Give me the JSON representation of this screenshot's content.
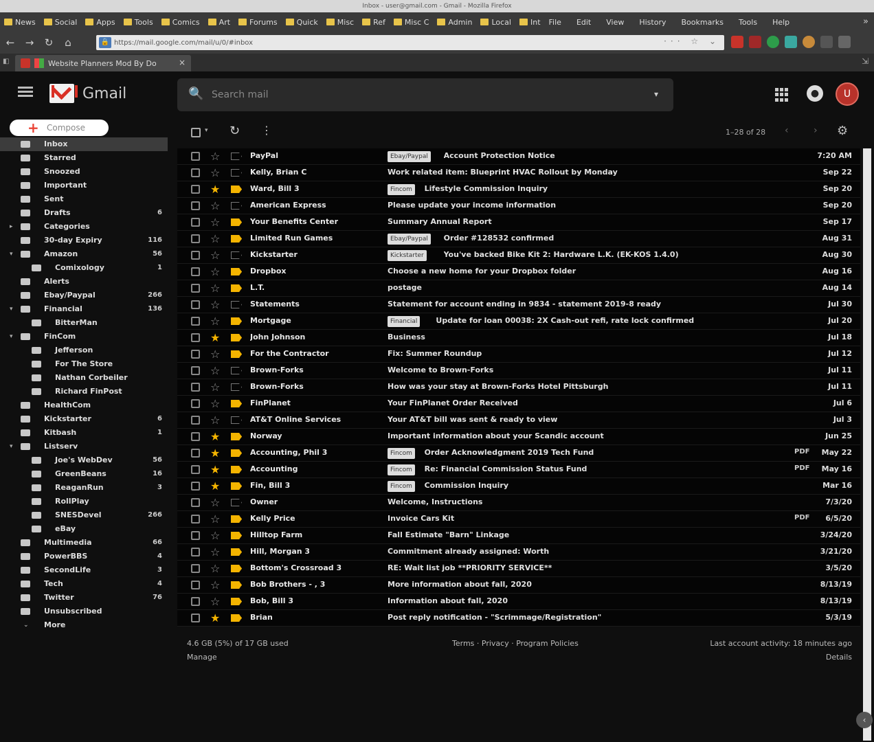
{
  "window": {
    "title": "Inbox - user@gmail.com - Gmail - Mozilla Firefox"
  },
  "menubar": {
    "items": [
      "File",
      "Edit",
      "View",
      "History",
      "Bookmarks",
      "Tools",
      "Help"
    ],
    "bookmarks": [
      "News",
      "Social",
      "Apps",
      "Tools",
      "Comics",
      "Art",
      "Forums",
      "Quick",
      "Misc",
      "Ref",
      "Misc C",
      "Admin",
      "Local",
      "Int"
    ]
  },
  "navbar": {
    "url": "https://mail.google.com/mail/u/0/#inbox"
  },
  "tab": {
    "title": "Website Planners Mod By Do",
    "close": "×"
  },
  "header": {
    "product_name": "Gmail",
    "search_placeholder": "Search mail",
    "avatar_initial": "U"
  },
  "sidebar": {
    "compose_label": "Compose",
    "items": [
      {
        "label": "Inbox",
        "count": "",
        "indent": 0,
        "caret": "",
        "active": true
      },
      {
        "label": "Starred",
        "count": "",
        "indent": 0,
        "caret": ""
      },
      {
        "label": "Snoozed",
        "count": "",
        "indent": 0,
        "caret": ""
      },
      {
        "label": "Important",
        "count": "",
        "indent": 0,
        "caret": ""
      },
      {
        "label": "Sent",
        "count": "",
        "indent": 0,
        "caret": ""
      },
      {
        "label": "Drafts",
        "count": "6",
        "indent": 0,
        "caret": ""
      },
      {
        "label": "Categories",
        "count": "",
        "indent": 0,
        "caret": "▸"
      },
      {
        "label": "30-day Expiry",
        "count": "116",
        "indent": 0,
        "caret": ""
      },
      {
        "label": "Amazon",
        "count": "56",
        "indent": 0,
        "caret": "▾"
      },
      {
        "label": "Comixology",
        "count": "1",
        "indent": 1,
        "caret": ""
      },
      {
        "label": "Alerts",
        "count": "",
        "indent": 0,
        "caret": ""
      },
      {
        "label": "Ebay/Paypal",
        "count": "266",
        "indent": 0,
        "caret": ""
      },
      {
        "label": "Financial",
        "count": "136",
        "indent": 0,
        "caret": "▾"
      },
      {
        "label": "BitterMan",
        "count": "",
        "indent": 1,
        "caret": ""
      },
      {
        "label": "FinCom",
        "count": "",
        "indent": 0,
        "caret": "▾"
      },
      {
        "label": "Jefferson",
        "count": "",
        "indent": 1,
        "caret": ""
      },
      {
        "label": "For The Store",
        "count": "",
        "indent": 1,
        "caret": ""
      },
      {
        "label": "Nathan Corbeiler",
        "count": "",
        "indent": 1,
        "caret": ""
      },
      {
        "label": "Richard FinPost",
        "count": "",
        "indent": 1,
        "caret": ""
      },
      {
        "label": "HealthCom",
        "count": "",
        "indent": 0,
        "caret": ""
      },
      {
        "label": "Kickstarter",
        "count": "6",
        "indent": 0,
        "caret": ""
      },
      {
        "label": "Kitbash",
        "count": "1",
        "indent": 0,
        "caret": ""
      },
      {
        "label": "Listserv",
        "count": "",
        "indent": 0,
        "caret": "▾"
      },
      {
        "label": "Joe's WebDev",
        "count": "56",
        "indent": 1,
        "caret": ""
      },
      {
        "label": "GreenBeans",
        "count": "16",
        "indent": 1,
        "caret": ""
      },
      {
        "label": "ReaganRun",
        "count": "3",
        "indent": 1,
        "caret": ""
      },
      {
        "label": "RollPlay",
        "count": "",
        "indent": 1,
        "caret": ""
      },
      {
        "label": "SNESDevel",
        "count": "266",
        "indent": 1,
        "caret": ""
      },
      {
        "label": "eBay",
        "count": "",
        "indent": 1,
        "caret": ""
      },
      {
        "label": "Multimedia",
        "count": "66",
        "indent": 0,
        "caret": ""
      },
      {
        "label": "PowerBBS",
        "count": "4",
        "indent": 0,
        "caret": ""
      },
      {
        "label": "SecondLife",
        "count": "3",
        "indent": 0,
        "caret": ""
      },
      {
        "label": "Tech",
        "count": "4",
        "indent": 0,
        "caret": ""
      },
      {
        "label": "Twitter",
        "count": "76",
        "indent": 0,
        "caret": ""
      },
      {
        "label": "Unsubscribed",
        "count": "",
        "indent": 0,
        "caret": ""
      },
      {
        "label": "More",
        "count": "",
        "indent": 0,
        "caret": "⌄",
        "more": true
      }
    ]
  },
  "toolbar": {
    "range": "1–28 of 28",
    "prev": "‹",
    "next": "›"
  },
  "emails": [
    {
      "sender": "PayPal",
      "tag": "Ebay/Paypal",
      "subject": "Account Protection Notice",
      "date": "7:20 AM",
      "starred": false,
      "important": false,
      "attachment": ""
    },
    {
      "sender": "Kelly, Brian C",
      "tag": "",
      "subject": "Work related item: Blueprint HVAC Rollout by Monday",
      "date": "Sep 22",
      "starred": false,
      "important": false,
      "attachment": ""
    },
    {
      "sender": "Ward, Bill 3",
      "tag": "Fincom",
      "subject": "Lifestyle Commission Inquiry",
      "date": "Sep 20",
      "starred": true,
      "important": true,
      "attachment": ""
    },
    {
      "sender": "American Express",
      "tag": "",
      "subject": "Please update your income information",
      "date": "Sep 20",
      "starred": false,
      "important": false,
      "attachment": ""
    },
    {
      "sender": "Your Benefits Center",
      "tag": "",
      "subject": "Summary Annual Report",
      "date": "Sep 17",
      "starred": false,
      "important": true,
      "attachment": ""
    },
    {
      "sender": "Limited Run Games",
      "tag": "Ebay/Paypal",
      "subject": "Order #128532 confirmed",
      "date": "Aug 31",
      "starred": false,
      "important": true,
      "attachment": ""
    },
    {
      "sender": "Kickstarter",
      "tag": "Kickstarter",
      "subject": "You've backed Bike Kit 2: Hardware L.K. (EK-KOS 1.4.0)",
      "date": "Aug 30",
      "starred": false,
      "important": false,
      "attachment": ""
    },
    {
      "sender": "Dropbox",
      "tag": "",
      "subject": "Choose a new home for your Dropbox folder",
      "date": "Aug 16",
      "starred": false,
      "important": true,
      "attachment": ""
    },
    {
      "sender": "L.T.",
      "tag": "",
      "subject": "postage",
      "date": "Aug 14",
      "starred": false,
      "important": true,
      "attachment": ""
    },
    {
      "sender": "Statements",
      "tag": "",
      "subject": "Statement for account ending in 9834 - statement 2019-8 ready",
      "date": "Jul 30",
      "starred": false,
      "important": false,
      "attachment": ""
    },
    {
      "sender": "Mortgage",
      "tag": "Financial",
      "subject": "Update for loan 00038: 2X Cash-out refi, rate lock confirmed",
      "date": "Jul 20",
      "starred": false,
      "important": true,
      "attachment": ""
    },
    {
      "sender": "John Johnson",
      "tag": "",
      "subject": "Business",
      "date": "Jul 18",
      "starred": true,
      "important": true,
      "attachment": ""
    },
    {
      "sender": "For the Contractor",
      "tag": "",
      "subject": "Fix: Summer Roundup",
      "date": "Jul 12",
      "starred": false,
      "important": true,
      "attachment": ""
    },
    {
      "sender": "Brown-Forks",
      "tag": "",
      "subject": "Welcome to Brown-Forks",
      "date": "Jul 11",
      "starred": false,
      "important": false,
      "attachment": ""
    },
    {
      "sender": "Brown-Forks",
      "tag": "",
      "subject": "How was your stay at Brown-Forks Hotel Pittsburgh",
      "date": "Jul 11",
      "starred": false,
      "important": false,
      "attachment": ""
    },
    {
      "sender": "FinPlanet",
      "tag": "",
      "subject": "Your FinPlanet Order Received",
      "date": "Jul 6",
      "starred": false,
      "important": true,
      "attachment": ""
    },
    {
      "sender": "AT&T Online Services",
      "tag": "",
      "subject": "Your AT&T bill was sent & ready to view",
      "date": "Jul 3",
      "starred": false,
      "important": false,
      "attachment": ""
    },
    {
      "sender": "Norway",
      "tag": "",
      "subject": "Important information about your Scandic account",
      "date": "Jun 25",
      "starred": true,
      "important": true,
      "attachment": ""
    },
    {
      "sender": "Accounting, Phil 3",
      "tag": "Fincom",
      "subject": "Order Acknowledgment 2019 Tech Fund",
      "date": "May 22",
      "starred": true,
      "important": true,
      "attachment": "PDF"
    },
    {
      "sender": "Accounting",
      "tag": "Fincom",
      "subject": "Re: Financial Commission Status Fund",
      "date": "May 16",
      "starred": true,
      "important": true,
      "attachment": "PDF"
    },
    {
      "sender": "Fin, Bill 3",
      "tag": "Fincom",
      "subject": "Commission Inquiry",
      "date": "Mar 16",
      "starred": true,
      "important": true,
      "attachment": ""
    },
    {
      "sender": "Owner",
      "tag": "",
      "subject": "Welcome, Instructions",
      "date": "7/3/20",
      "starred": false,
      "important": false,
      "attachment": ""
    },
    {
      "sender": "Kelly Price",
      "tag": "",
      "subject": "Invoice Cars Kit",
      "date": "6/5/20",
      "starred": false,
      "important": true,
      "attachment": "PDF"
    },
    {
      "sender": "Hilltop Farm",
      "tag": "",
      "subject": "Fall Estimate \"Barn\" Linkage",
      "date": "3/24/20",
      "starred": false,
      "important": true,
      "attachment": ""
    },
    {
      "sender": "Hill, Morgan 3",
      "tag": "",
      "subject": "Commitment already assigned: Worth",
      "date": "3/21/20",
      "starred": false,
      "important": true,
      "attachment": ""
    },
    {
      "sender": "Bottom's Crossroad 3",
      "tag": "",
      "subject": "RE: Wait list job **PRIORITY SERVICE**",
      "date": "3/5/20",
      "starred": false,
      "important": true,
      "attachment": ""
    },
    {
      "sender": "Bob Brothers - , 3",
      "tag": "",
      "subject": "More information about fall, 2020",
      "date": "8/13/19",
      "starred": false,
      "important": true,
      "attachment": ""
    },
    {
      "sender": "Bob, Bill 3",
      "tag": "",
      "subject": "Information about fall, 2020",
      "date": "8/13/19",
      "starred": false,
      "important": true,
      "attachment": ""
    },
    {
      "sender": "Brian",
      "tag": "",
      "subject": "Post reply notification - \"Scrimmage/Registration\"",
      "date": "5/3/19",
      "starred": true,
      "important": true,
      "attachment": ""
    }
  ],
  "footer": {
    "storage": "4.6 GB (5%) of 17 GB used",
    "manage": "Manage",
    "links": "Terms · Privacy · Program Policies",
    "activity": "Last account activity: 18 minutes ago",
    "details": "Details"
  }
}
